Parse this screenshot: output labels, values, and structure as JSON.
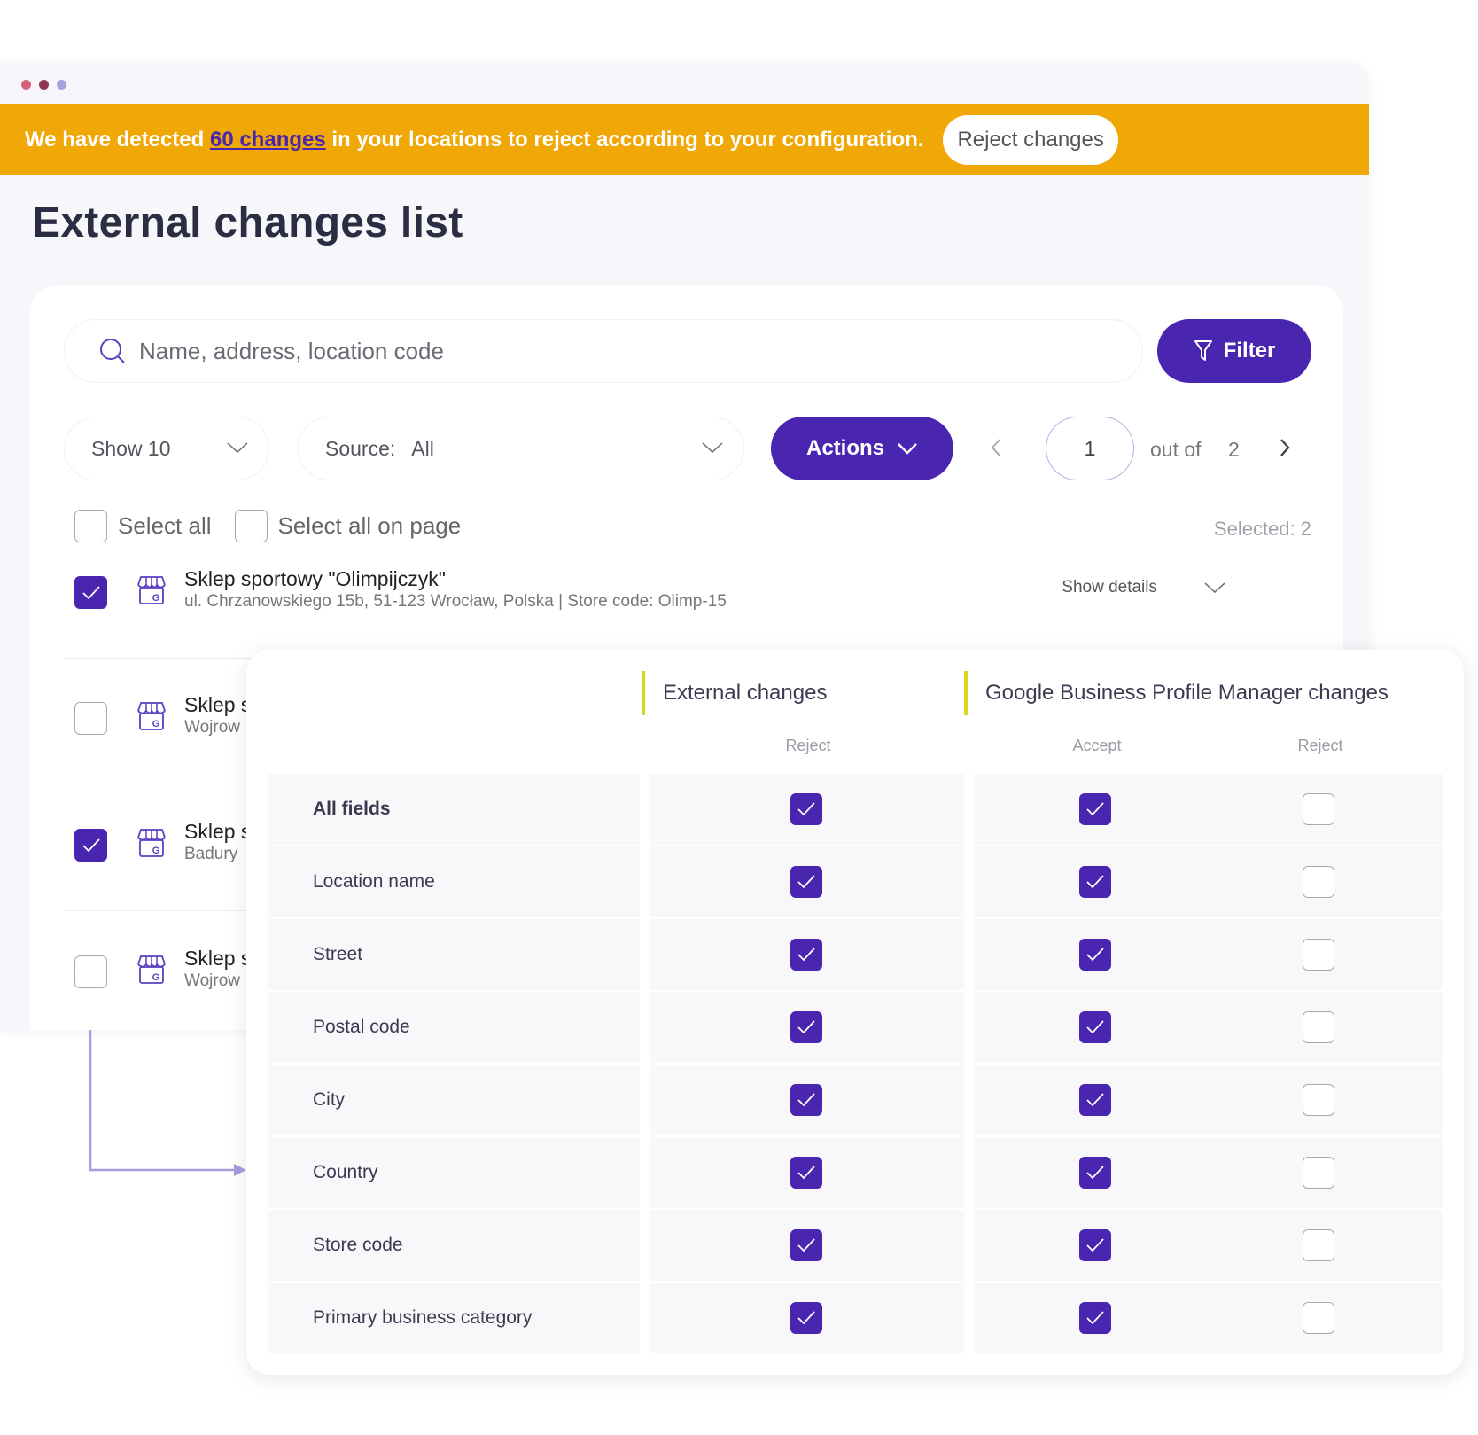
{
  "window": {
    "dots": [
      "#d8607f",
      "#8e3552",
      "#a9a0e0"
    ]
  },
  "banner": {
    "text_before": "We have detected ",
    "link_text": "60 changes",
    "text_after": " in your locations to reject according to your configuration.",
    "button_label": "Reject changes",
    "background": "#f0a806"
  },
  "page": {
    "title": "External changes list"
  },
  "toolbar": {
    "search_placeholder": "Name, address, location code",
    "filter_label": "Filter",
    "show_label": "Show 10",
    "source_label": "Source:",
    "source_value": "All",
    "actions_label": "Actions",
    "page_current": "1",
    "page_of_label": "out of",
    "page_total": "2",
    "accent": "#4a25b0"
  },
  "selection": {
    "select_all_label": "Select all",
    "select_all_on_page_label": "Select all on page",
    "selected_count_label": "Selected: 2"
  },
  "locations": [
    {
      "name": "Sklep sportowy \"Olimpijczyk\"",
      "address": "ul. Chrzanowskiego 15b, 51-123 Wrocław, Polska | Store code: Olimp-15",
      "checked": true,
      "details_label": "Show details"
    },
    {
      "name": "Sklep s",
      "address": "Wojrow",
      "checked": false
    },
    {
      "name": "Sklep s",
      "address": "Badury",
      "checked": true
    },
    {
      "name": "Sklep s",
      "address": "Wojrow",
      "checked": false
    }
  ],
  "details_panel": {
    "external_heading": "External changes",
    "gbp_heading": "Google Business Profile Manager changes",
    "external_reject": "Reject",
    "gbp_accept": "Accept",
    "gbp_reject": "Reject",
    "rows": [
      {
        "field": "All fields",
        "external_reject": true,
        "gbp_accept": true,
        "gbp_reject": false
      },
      {
        "field": "Location name",
        "external_reject": true,
        "gbp_accept": true,
        "gbp_reject": false
      },
      {
        "field": "Street",
        "external_reject": true,
        "gbp_accept": true,
        "gbp_reject": false
      },
      {
        "field": "Postal code",
        "external_reject": true,
        "gbp_accept": true,
        "gbp_reject": false
      },
      {
        "field": "City",
        "external_reject": true,
        "gbp_accept": true,
        "gbp_reject": false
      },
      {
        "field": "Country",
        "external_reject": true,
        "gbp_accept": true,
        "gbp_reject": false
      },
      {
        "field": "Store code",
        "external_reject": true,
        "gbp_accept": true,
        "gbp_reject": false
      },
      {
        "field": "Primary business category",
        "external_reject": true,
        "gbp_accept": true,
        "gbp_reject": false
      }
    ]
  }
}
